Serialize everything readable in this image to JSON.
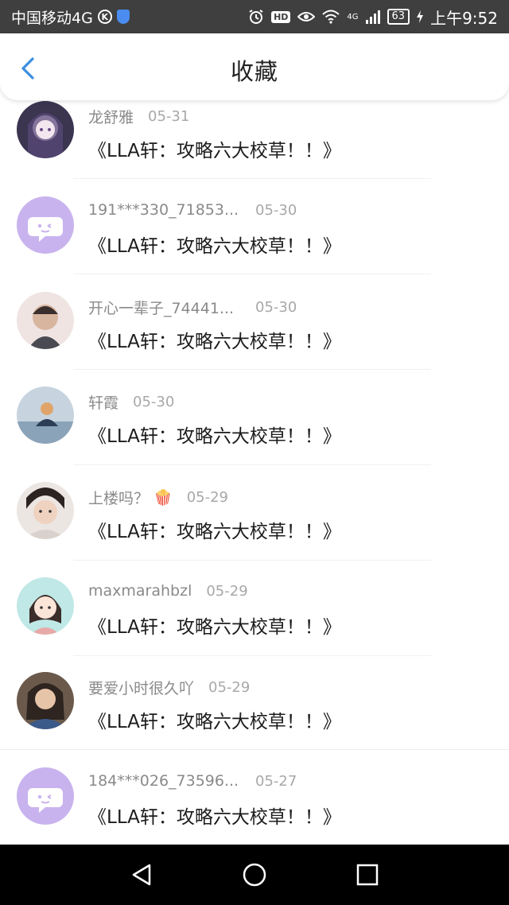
{
  "status_bar": {
    "carrier": "中国移动4G",
    "k_badge": "K",
    "hd": "HD",
    "network": "4G",
    "battery": "63",
    "time": "上午9:52"
  },
  "header": {
    "title": "收藏"
  },
  "list": [
    {
      "name": "龙舒雅",
      "date": "05-31",
      "title": "《LLA轩：攻略六大校草！！》",
      "avatar": "photo-anime"
    },
    {
      "name": "191***330_71853...",
      "date": "05-30",
      "title": "《LLA轩：攻略六大校草！！》",
      "avatar": "default-chat"
    },
    {
      "name": "开心一辈子_74441...",
      "date": "05-30",
      "title": "《LLA轩：攻略六大校草！！》",
      "avatar": "photo-person"
    },
    {
      "name": "轩霞",
      "date": "05-30",
      "title": "《LLA轩：攻略六大校草！！》",
      "avatar": "photo-beach"
    },
    {
      "name": "上楼吗？",
      "emoji": "🍿",
      "date": "05-29",
      "title": "《LLA轩：攻略六大校草！！》",
      "avatar": "photo-boy"
    },
    {
      "name": "maxmarahbzl",
      "date": "05-29",
      "title": "《LLA轩：攻略六大校草！！》",
      "avatar": "photo-cartoon-girl"
    },
    {
      "name": "要爱小时很久吖",
      "date": "05-29",
      "title": "《LLA轩：攻略六大校草！！》",
      "avatar": "photo-girl"
    },
    {
      "name": "184***026_73596...",
      "date": "05-27",
      "title": "《LLA轩：攻略六大校草！！》",
      "avatar": "default-chat"
    }
  ],
  "colors": {
    "status_bg": "#3f3f3f",
    "accent": "#3b8de0",
    "default_avatar": "#c9b3ee"
  }
}
